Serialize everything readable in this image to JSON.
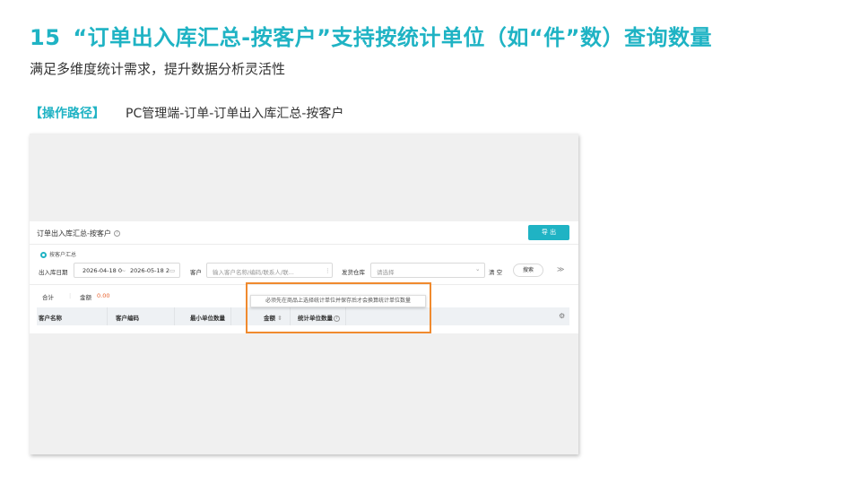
{
  "slide": {
    "number": "15",
    "title": "“订单出入库汇总-按客户”支持按统计单位（如“件”数）查询数量",
    "subtitle": "满足多维度统计需求，提升数据分析灵活性",
    "path_label": "【操作路径】",
    "path_value": "PC管理端-订单-订单出入库汇总-按客户"
  },
  "app": {
    "page_title": "订单出入库汇总-按客户",
    "export_label": "导 出",
    "radio_label": "按客户汇总",
    "filters": {
      "date_label": "出入库日期",
      "date_start": "2026-04-18 0",
      "date_sep": "~",
      "date_end": "2026-05-18 2",
      "customer_label": "客户",
      "customer_placeholder": "输入客户名称/编码/联系人/联...",
      "warehouse_label": "发货仓库",
      "warehouse_placeholder": "请选择",
      "clear_label": "清 空",
      "search_label": "搜索"
    },
    "summary": {
      "total_label": "合计",
      "amount_label": "金额",
      "amount_value": "0.00"
    },
    "table_headers": [
      "客户名称",
      "客户编码",
      "最小单位数量",
      "金额",
      "统计单位数量"
    ],
    "tooltip": "必须先在商品上选择统计单位并保存后才会换算统计单位数量"
  },
  "colors": {
    "accent": "#1fb3c4",
    "highlight_border": "#f08a2e",
    "amount_red": "#e8602c"
  }
}
